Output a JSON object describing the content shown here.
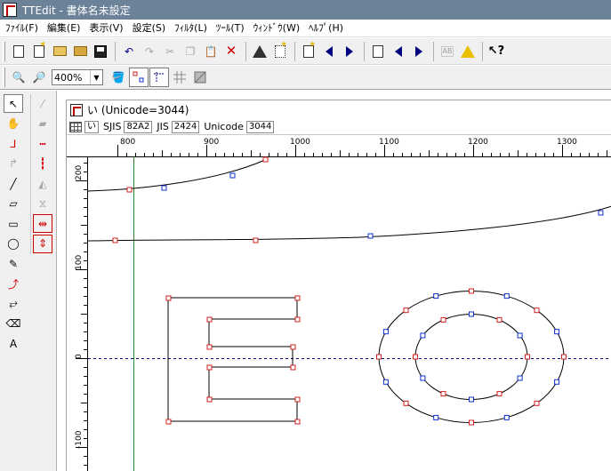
{
  "window": {
    "title": "TTEdit - 書体名未設定"
  },
  "menu": [
    {
      "id": "file",
      "label": "ﾌｧｲﾙ(F)"
    },
    {
      "id": "edit",
      "label": "編集(E)"
    },
    {
      "id": "view",
      "label": "表示(V)"
    },
    {
      "id": "settings",
      "label": "設定(S)"
    },
    {
      "id": "filter",
      "label": "ﾌｨﾙﾀ(L)"
    },
    {
      "id": "tools",
      "label": "ﾂｰﾙ(T)"
    },
    {
      "id": "window",
      "label": "ｳｨﾝﾄﾞｳ(W)"
    },
    {
      "id": "help",
      "label": "ﾍﾙﾌﾟ(H)"
    }
  ],
  "toolbar2": {
    "zoom_value": "400%"
  },
  "child": {
    "title": "い (Unicode=3044)",
    "char": "い",
    "sjis_label": "SJIS",
    "sjis_value": "82A2",
    "jis_label": "JIS",
    "jis_value": "2424",
    "unicode_label": "Unicode",
    "unicode_value": "3044"
  },
  "ruler": {
    "top_labels": [
      "800",
      "900",
      "1000",
      "1100",
      "1200",
      "1300"
    ],
    "left_labels": [
      "200",
      "100",
      "0",
      "-100"
    ]
  },
  "colors": {
    "on_curve_point": "#d02020",
    "off_curve_point": "#1030d0",
    "baseline": "#000080",
    "vertical_guide": "#2a8a2a"
  }
}
